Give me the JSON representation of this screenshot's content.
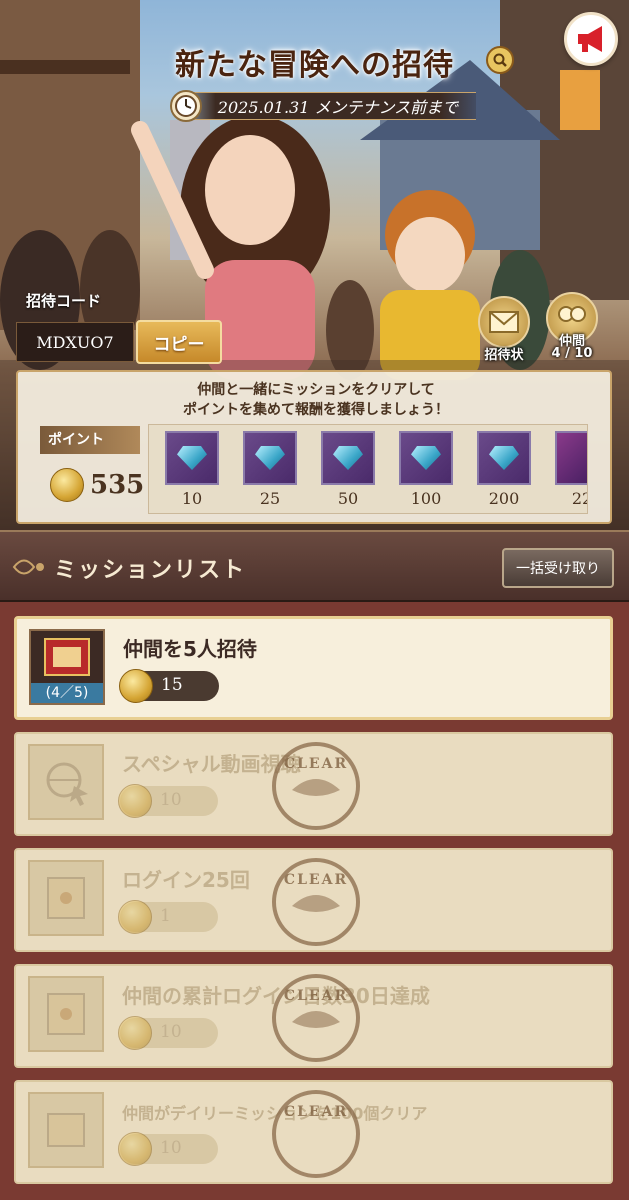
{
  "banner": {
    "title": "新たな冒険への招待",
    "deadline": "2025.01.31 メンテナンス前まで",
    "invite_code_label": "招待コード",
    "invite_code": "MDXUO7",
    "copy_label": "コピー",
    "invitation_label": "招待状",
    "friends_label": "仲間",
    "friends_count": "4 / 10"
  },
  "rewards": {
    "message_line1": "仲間と一緒にミッションをクリアして",
    "message_line2": "ポイントを集めて報酬を獲得しましょう！",
    "points_label": "ポイント",
    "points_value": "535",
    "milestones": [
      "10",
      "25",
      "50",
      "100",
      "200",
      "22"
    ]
  },
  "missions_header": {
    "title": "ミッションリスト",
    "claim_all_label": "一括受け取り"
  },
  "missions": [
    {
      "name": "仲間を5人招待",
      "reward": "15",
      "progress": "(4／5)",
      "status": "active"
    },
    {
      "name": "スペシャル動画視聴",
      "reward": "10",
      "status": "cleared"
    },
    {
      "name": "ログイン25回",
      "reward": "1",
      "status": "cleared"
    },
    {
      "name": "仲間の累計ログイン日数30日達成",
      "reward": "10",
      "status": "cleared"
    },
    {
      "name": "仲間がデイリーミッションを100個クリア",
      "reward": "10",
      "status": "cleared"
    }
  ],
  "stamp_text": "CLEAR",
  "colors": {
    "accent_gold": "#e7b95a",
    "panel_bg": "#f5ecd6",
    "list_bg": "#7a3a32"
  }
}
